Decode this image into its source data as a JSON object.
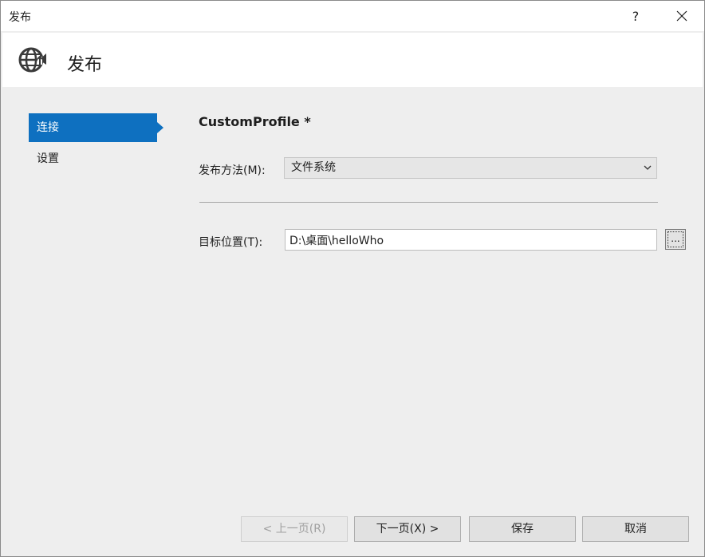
{
  "window": {
    "title": "发布",
    "help_label": "?"
  },
  "header": {
    "title": "发布",
    "icon": "globe-publish-icon"
  },
  "nav": {
    "items": [
      {
        "label": "连接",
        "active": true
      },
      {
        "label": "设置",
        "active": false
      }
    ]
  },
  "main": {
    "profile_title": "CustomProfile *",
    "method_label": "发布方法(M):",
    "method_value": "文件系统",
    "target_label": "目标位置(T):",
    "target_value": "D:\\桌面\\helloWho",
    "browse_label": "..."
  },
  "buttons": {
    "prev": "< 上一页(R)",
    "next": "下一页(X) >",
    "save": "保存",
    "cancel": "取消"
  },
  "colors": {
    "accent": "#0e70c0",
    "background": "#eeeeee",
    "header_background": "#ffffff"
  }
}
